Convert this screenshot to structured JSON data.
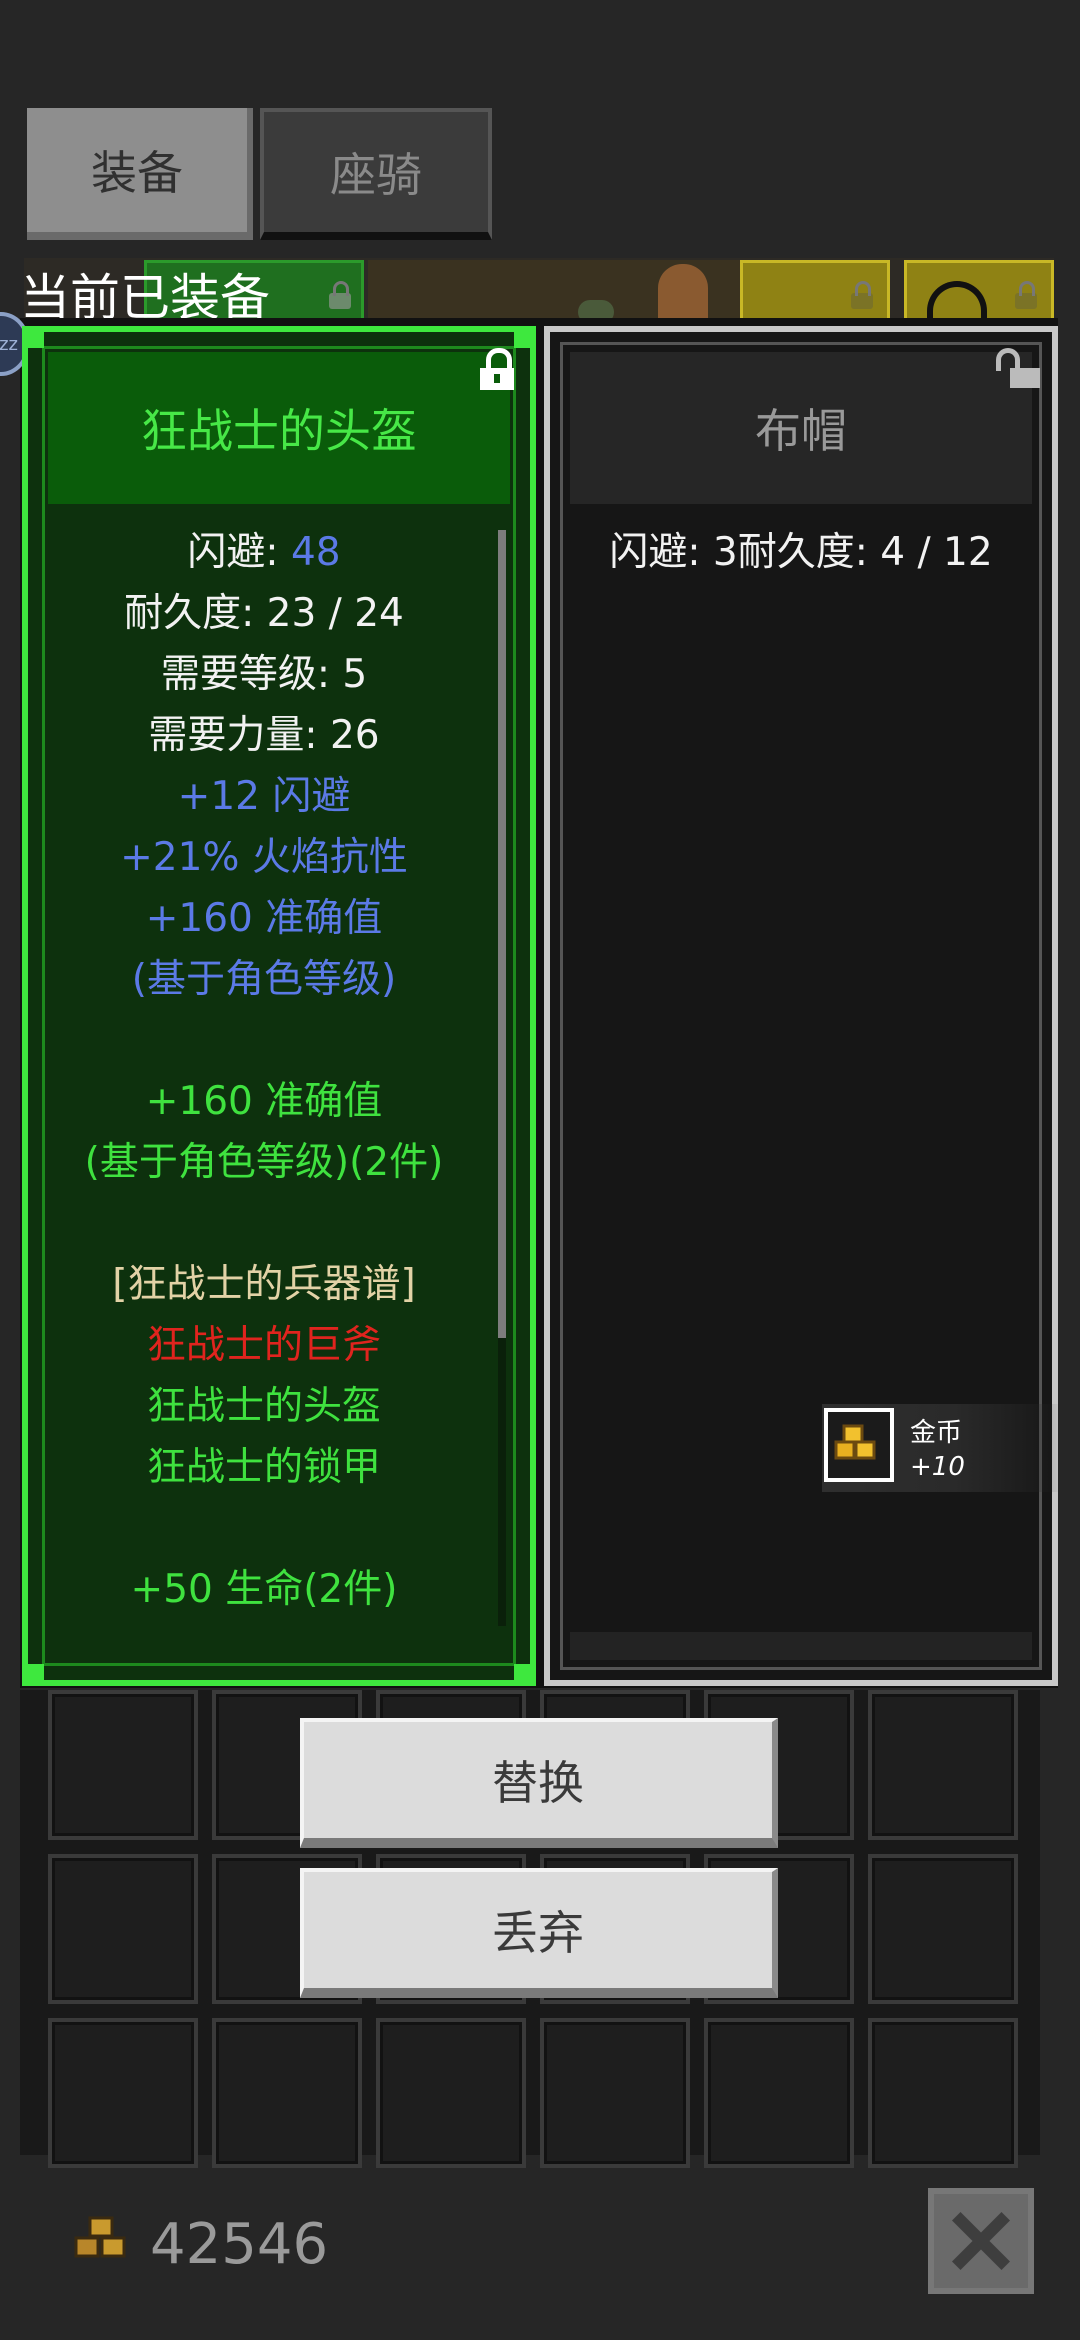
{
  "tabs": [
    {
      "label": "装备",
      "active": true
    },
    {
      "label": "座骑",
      "active": false
    }
  ],
  "section_title": "当前已装备",
  "sleep_badge": "zz",
  "equipped_item": {
    "name": "狂战士的头盔",
    "locked": true,
    "lines": [
      {
        "parts": [
          {
            "text": "闪避: ",
            "color": "white"
          },
          {
            "text": "48",
            "color": "blue"
          }
        ]
      },
      {
        "parts": [
          {
            "text": "耐久度: 23 / 24",
            "color": "white"
          }
        ]
      },
      {
        "parts": [
          {
            "text": "需要等级: 5",
            "color": "white"
          }
        ]
      },
      {
        "parts": [
          {
            "text": "需要力量: 26",
            "color": "white"
          }
        ]
      },
      {
        "parts": [
          {
            "text": "+12 闪避",
            "color": "blue"
          }
        ]
      },
      {
        "parts": [
          {
            "text": "+21% 火焰抗性",
            "color": "blue"
          }
        ]
      },
      {
        "parts": [
          {
            "text": "+160 准确值",
            "color": "blue"
          }
        ]
      },
      {
        "parts": [
          {
            "text": "(基于角色等级)",
            "color": "blue"
          }
        ]
      },
      {
        "parts": [
          {
            "text": "",
            "color": "white"
          }
        ]
      },
      {
        "parts": [
          {
            "text": "+160 准确值",
            "color": "green"
          }
        ]
      },
      {
        "parts": [
          {
            "text": "(基于角色等级)(2件)",
            "color": "green"
          }
        ]
      },
      {
        "parts": [
          {
            "text": "",
            "color": "white"
          }
        ]
      },
      {
        "parts": [
          {
            "text": "[狂战士的兵器谱]",
            "color": "tan"
          }
        ]
      },
      {
        "parts": [
          {
            "text": "狂战士的巨斧",
            "color": "red"
          }
        ]
      },
      {
        "parts": [
          {
            "text": "狂战士的头盔",
            "color": "green"
          }
        ]
      },
      {
        "parts": [
          {
            "text": "狂战士的锁甲",
            "color": "green"
          }
        ]
      },
      {
        "parts": [
          {
            "text": "",
            "color": "white"
          }
        ]
      },
      {
        "parts": [
          {
            "text": "+50 生命(2件)",
            "color": "green"
          }
        ]
      }
    ]
  },
  "compare_item": {
    "name": "布帽",
    "locked": false,
    "lines": [
      {
        "parts": [
          {
            "text": "闪避: 3",
            "color": "white"
          }
        ]
      },
      {
        "parts": [
          {
            "text": "耐久度: 4 / 12",
            "color": "white"
          }
        ]
      }
    ]
  },
  "pickup_toast": {
    "name": "金币",
    "amount": "+10",
    "icon": "gold-coins-icon"
  },
  "buttons": {
    "replace": "替换",
    "discard": "丢弃"
  },
  "footer": {
    "gold_amount": "42546",
    "gold_icon": "gold-coins-icon",
    "close_icon": "close-icon"
  },
  "colors": {
    "white": "#f2f2f2",
    "blue": "#5b7ae6",
    "green": "#3fe23f",
    "tan": "#e2d2a6",
    "red": "#e0241e",
    "equipped_border": "#3ee83e",
    "compare_border": "#c8c8c8"
  }
}
